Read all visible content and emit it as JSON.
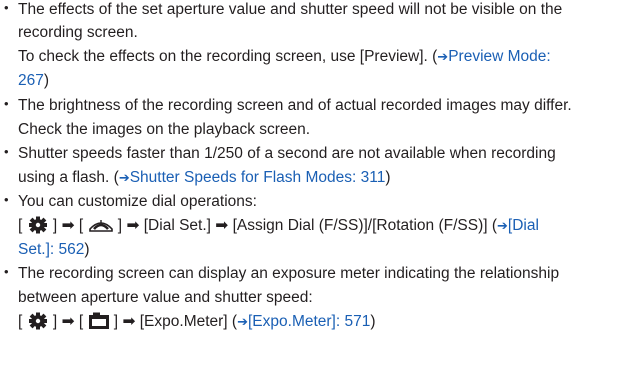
{
  "bullets": [
    {
      "l1": "The effects of the set aperture value and shutter speed will not be visible on the",
      "l2": "recording screen.",
      "l3a": "To check the effects on the recording screen, use [Preview]. (",
      "l3_link": "Preview Mode:",
      "l4_link": "267",
      "l4b": ")"
    },
    {
      "l1": "The brightness of the recording screen and of actual recorded images may differ.",
      "l2": "Check the images on the playback screen."
    },
    {
      "l1": "Shutter speeds faster than 1/250 of a second are not available when recording",
      "l2a": "using a flash. (",
      "l2_link": "Shutter Speeds for Flash Modes: 311",
      "l2b": ")"
    },
    {
      "l1": "You can customize dial operations:",
      "l2a": "[ ",
      "l2b": " ]",
      "l2c": "[ ",
      "l2d": " ]",
      "l2e": "[Dial Set.]",
      "l2f": "[Assign Dial (F/SS)]/[Rotation (F/SS)] (",
      "l2_link": "[Dial",
      "l3_link": "Set.]: 562",
      "l3b": ")"
    },
    {
      "l1": "The recording screen can display an exposure meter indicating the relationship",
      "l2": "between aperture value and shutter speed:",
      "l3a": "[ ",
      "l3b": " ]",
      "l3c": "[ ",
      "l3d": " ]",
      "l3e": "[Expo.Meter] (",
      "l3_link": "[Expo.Meter]: 571",
      "l3f": ")"
    }
  ],
  "icons": {
    "bullet": "•",
    "arrow": "➔",
    "menu_arrow": "➡",
    "custom_menu": "gear-cog-icon",
    "operation_menu": "dial-icon",
    "monitor_display": "camera-monitor-icon"
  },
  "colors": {
    "text": "#231f20",
    "link": "#1a5fb4"
  }
}
